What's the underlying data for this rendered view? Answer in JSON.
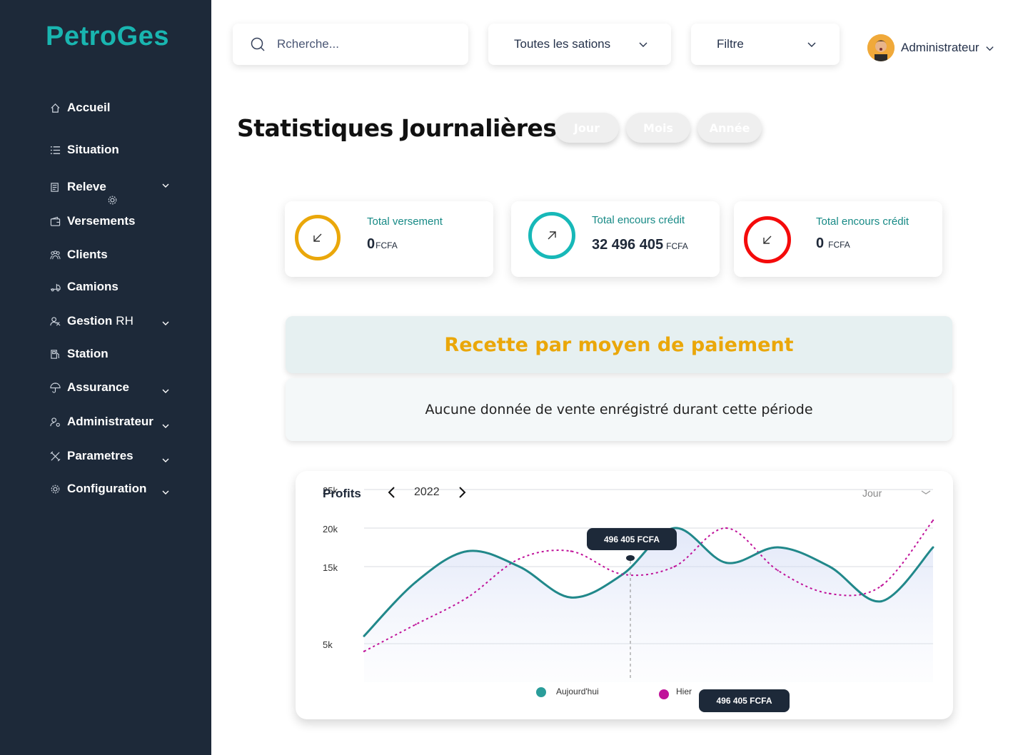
{
  "sidebar": {
    "brand": "PetroGes",
    "items": [
      {
        "label": "Accueil",
        "icon": "home-icon"
      },
      {
        "label": "Situation",
        "icon": "list-icon"
      },
      {
        "label": "Releve",
        "icon": "readings-icon"
      },
      {
        "label": "Versements",
        "icon": "wallet-icon"
      },
      {
        "label": "Clients",
        "icon": "users-icon"
      },
      {
        "label": "Camions",
        "icon": "truck-icon"
      },
      {
        "label_bold": "Gestion",
        "label_light": "RH",
        "icon": "hr-icon"
      },
      {
        "label": "Station",
        "icon": "station-icon"
      },
      {
        "label": "Assurance",
        "icon": "insurance-icon"
      },
      {
        "label": "Administrateur",
        "icon": "admin-icon"
      },
      {
        "label": "Parametres",
        "icon": "tools-icon"
      },
      {
        "label": "Configuration",
        "icon": "gear-icon"
      }
    ]
  },
  "header": {
    "search_placeholder": "Rcherche...",
    "station_select": "Toutes les sations",
    "filter_select": "Filtre",
    "user_name": "Administrateur"
  },
  "title": "Statistiques Journalières",
  "periods": [
    {
      "label": "Jour",
      "color": "#f0ad0a"
    },
    {
      "label": "Mois",
      "color": "#f40b0b"
    },
    {
      "label": "Année",
      "color": "#17b8b8"
    }
  ],
  "stats": [
    {
      "label": "Total versement",
      "value": "0",
      "unit": "FCFA",
      "color": "#eaa70a",
      "arrow": "down-left"
    },
    {
      "label": "Total encours crédit",
      "value": "32 496 405",
      "unit": "FCFA",
      "color": "#17b8b8",
      "arrow": "up-right"
    },
    {
      "label": "Total encours crédit",
      "value": "0",
      "unit": "FCFA",
      "color": "#f40b0b",
      "arrow": "down-left"
    }
  ],
  "payment": {
    "title": "Recette par moyen de paiement",
    "empty_message": "Aucune donnée de vente enrégistré durant cette période"
  },
  "profits": {
    "title": "Profits",
    "year": "2022",
    "period": "Jour",
    "tooltip_top": "496 405 FCFA",
    "tooltip_bottom": "496 405 FCFA",
    "legend": [
      {
        "name": "Aujourd'hui",
        "color": "#2a9d9a"
      },
      {
        "name": "Hier",
        "color": "#c0139a"
      }
    ]
  },
  "chart_data": {
    "type": "line",
    "title": "Profits",
    "ytick_labels": [
      "25k",
      "20k",
      "15k",
      "5k"
    ],
    "series": [
      {
        "name": "Aujourd'hui",
        "color": "#21888a",
        "x": [
          0,
          1,
          2,
          3,
          4,
          5,
          6,
          7,
          8,
          9,
          10,
          11
        ],
        "values": [
          6,
          13,
          17,
          15,
          11,
          14,
          20,
          15.5,
          17.5,
          15,
          10.5,
          17.5
        ]
      },
      {
        "name": "Hier",
        "color": "#c0139a",
        "x": [
          0,
          1,
          2,
          3,
          4,
          5,
          6,
          7,
          8,
          9,
          10,
          11
        ],
        "values": [
          4,
          7.5,
          11,
          16,
          17,
          14,
          15,
          20,
          14.5,
          11.5,
          12.5,
          21
        ]
      }
    ],
    "grid": true,
    "legend_position": "bottom-center"
  }
}
